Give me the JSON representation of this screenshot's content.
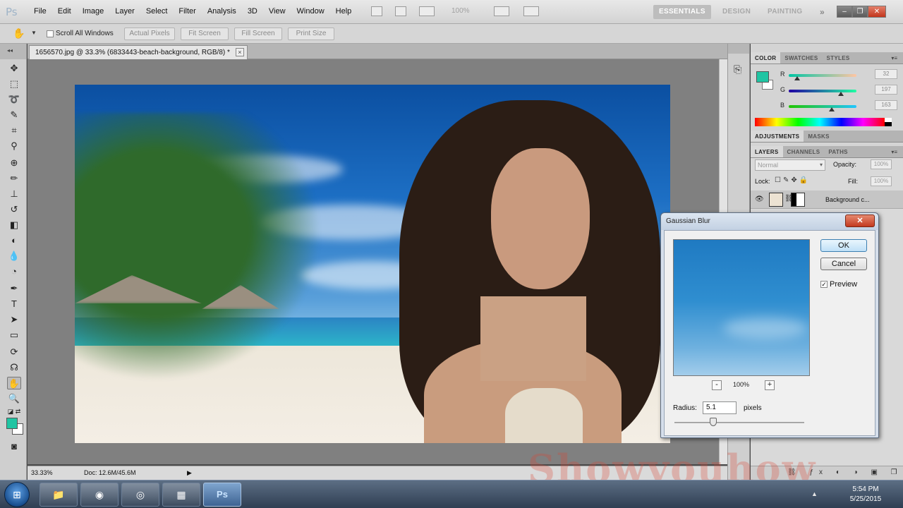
{
  "app": {
    "logo": "Ps"
  },
  "menu": {
    "items": [
      "File",
      "Edit",
      "Image",
      "Layer",
      "Select",
      "Filter",
      "Analysis",
      "3D",
      "View",
      "Window",
      "Help"
    ],
    "zoom": "100%"
  },
  "workspace": {
    "essentials": "ESSENTIALS",
    "design": "DESIGN",
    "painting": "PAINTING",
    "more": "»"
  },
  "options_bar": {
    "scroll_all_windows": "Scroll All Windows",
    "actual_pixels": "Actual Pixels",
    "fit_screen": "Fit Screen",
    "fill_screen": "Fill Screen",
    "print_size": "Print Size"
  },
  "document": {
    "tab_title": "1656570.jpg @ 33.3% (6833443-beach-background, RGB/8) *",
    "status_zoom": "33.33%",
    "status_doc": "Doc: 12.6M/45.6M"
  },
  "color_panel": {
    "tabs": [
      "COLOR",
      "SWATCHES",
      "STYLES"
    ],
    "fg_color": "#20c5a3",
    "r": {
      "label": "R",
      "value": "32",
      "level": 0.13
    },
    "g": {
      "label": "G",
      "value": "197",
      "level": 0.77
    },
    "b": {
      "label": "B",
      "value": "163",
      "level": 0.64
    }
  },
  "adjustments_tabs": [
    "ADJUSTMENTS",
    "MASKS"
  ],
  "layers_panel": {
    "tabs": [
      "LAYERS",
      "CHANNELS",
      "PATHS"
    ],
    "blend_mode": "Normal",
    "opacity_label": "Opacity:",
    "opacity": "100%",
    "lock_label": "Lock:",
    "fill_label": "Fill:",
    "fill": "100%",
    "layer_name": "Background c..."
  },
  "gaussian_blur": {
    "title": "Gaussian Blur",
    "ok": "OK",
    "cancel": "Cancel",
    "preview_label": "Preview",
    "zoom": "100%",
    "radius_label": "Radius:",
    "radius_value": "5.1",
    "units": "pixels",
    "radius_level": 0.3
  },
  "watermark": "Showyouhow",
  "taskbar": {
    "ps_label": "Ps",
    "time": "5:54 PM",
    "date": "5/25/2015"
  }
}
